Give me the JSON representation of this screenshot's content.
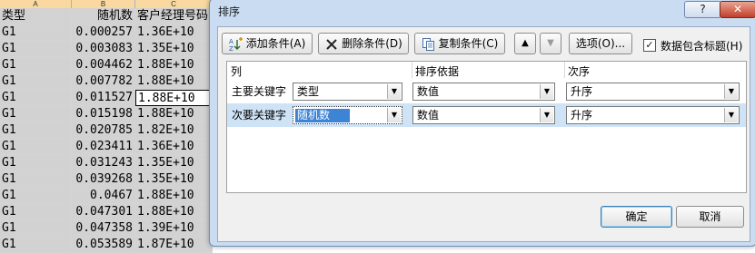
{
  "sheet": {
    "col_headers": [
      "A",
      "B",
      "C"
    ],
    "header_row": [
      "类型",
      "随机数",
      "客户经理号码"
    ],
    "rows": [
      [
        "G1",
        "0.000257",
        "1.36E+10"
      ],
      [
        "G1",
        "0.003083",
        "1.35E+10"
      ],
      [
        "G1",
        "0.004462",
        "1.88E+10"
      ],
      [
        "G1",
        "0.007782",
        "1.88E+10"
      ],
      [
        "G1",
        "0.011527",
        "1.88E+10"
      ],
      [
        "G1",
        "0.015198",
        "1.88E+10"
      ],
      [
        "G1",
        "0.020785",
        "1.82E+10"
      ],
      [
        "G1",
        "0.023411",
        "1.36E+10"
      ],
      [
        "G1",
        "0.031243",
        "1.35E+10"
      ],
      [
        "G1",
        "0.039268",
        "1.35E+10"
      ],
      [
        "G1",
        "0.0467",
        "1.88E+10"
      ],
      [
        "G1",
        "0.047301",
        "1.88E+10"
      ],
      [
        "G1",
        "0.047358",
        "1.39E+10"
      ],
      [
        "G1",
        "0.053589",
        "1.87E+10"
      ]
    ]
  },
  "dialog": {
    "title": "排序",
    "help_label": "?",
    "close_label": "✕",
    "toolbar": {
      "add_label": "添加条件(A)",
      "delete_label": "删除条件(D)",
      "copy_label": "复制条件(C)",
      "up_label": "▲",
      "down_label": "▼",
      "options_label": "选项(O)...",
      "header_checkbox_label": "数据包含标题(H)",
      "header_checkbox_mark": "✓"
    },
    "grid": {
      "col_column": "列",
      "col_sort_on": "排序依据",
      "col_order": "次序",
      "rows": [
        {
          "key_label": "主要关键字",
          "column": "类型",
          "sort_on": "数值",
          "order": "升序"
        },
        {
          "key_label": "次要关键字",
          "column": "随机数",
          "sort_on": "数值",
          "order": "升序"
        }
      ]
    },
    "ok_label": "确定",
    "cancel_label": "取消"
  },
  "colors": {
    "dialog_frame": "#c9dcf1",
    "selection": "#3d84d6",
    "selected_row": "#cfe3f6"
  }
}
